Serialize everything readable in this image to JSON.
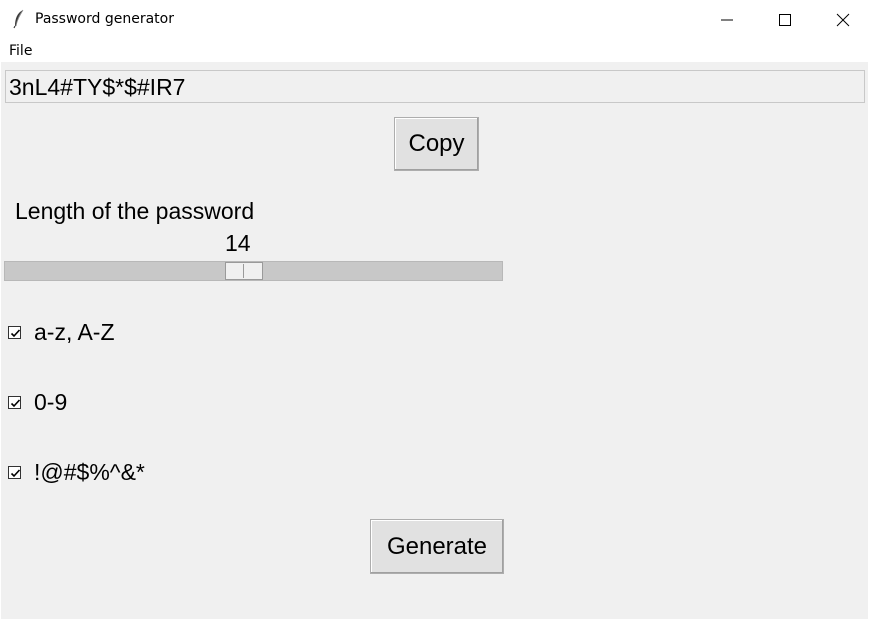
{
  "window": {
    "title": "Password generator",
    "app_icon": "feather-icon",
    "controls": [
      "minimize-icon",
      "maximize-icon",
      "close-icon"
    ]
  },
  "menu": {
    "file_label": "File"
  },
  "password": {
    "value": "3nL4#TY$*$#IR7"
  },
  "copy_button": {
    "label": "Copy"
  },
  "length": {
    "label": "Length of the password",
    "value": "14",
    "slider_position": 0.48
  },
  "options": [
    {
      "label": "a-z, A-Z",
      "checked": true
    },
    {
      "label": "0-9",
      "checked": true
    },
    {
      "label": "!@#$%^&*",
      "checked": true
    }
  ],
  "generate_button": {
    "label": "Generate"
  },
  "colors": {
    "client_bg": "#f0f0f0",
    "button_bg": "#e1e1e1",
    "trough": "#c8c8c8"
  }
}
